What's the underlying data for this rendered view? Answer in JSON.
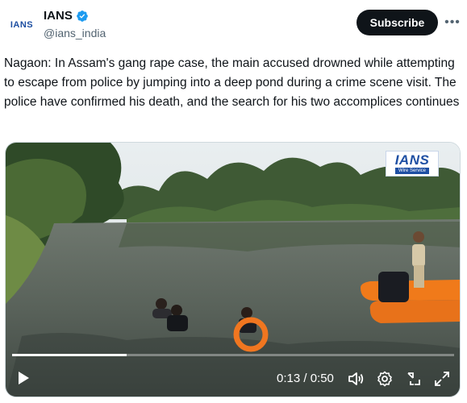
{
  "author": {
    "display_name": "IANS",
    "handle": "@ians_india",
    "avatar_text": "IANS"
  },
  "actions": {
    "subscribe_label": "Subscribe",
    "more_label": "•••"
  },
  "tweet": {
    "text": "Nagaon: In Assam's gang rape case, the main accused drowned while attempting to escape from police by jumping into a deep pond during a crime scene visit. The police have confirmed his death, and the search for his two accomplices continues"
  },
  "video": {
    "watermark_main": "IANS",
    "watermark_sub": "Wire Service",
    "current_time": "0:13",
    "duration": "0:50",
    "time_display": "0:13 / 0:50",
    "progress_fraction": 0.26,
    "icons": [
      "play-icon",
      "volume-icon",
      "settings-icon",
      "exit-fullscreen-icon",
      "fullscreen-icon"
    ]
  },
  "colors": {
    "verified": "#1d9bf0",
    "subscribe_bg": "#0f1419",
    "handle_gray": "#536471",
    "watermark_blue": "#1e4fa3"
  }
}
